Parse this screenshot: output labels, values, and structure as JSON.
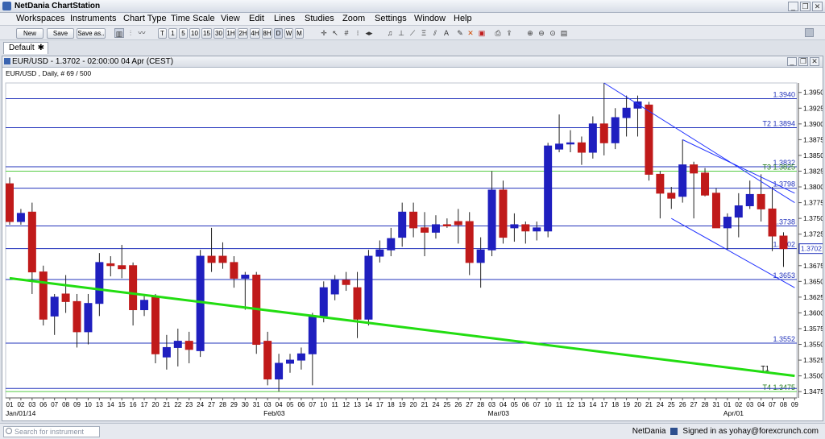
{
  "app": {
    "title": "NetDania ChartStation"
  },
  "menu": [
    "Workspaces",
    "Instruments",
    "Chart Type",
    "Time Scale",
    "View",
    "Edit",
    "Lines",
    "Studies",
    "Zoom",
    "Settings",
    "Window",
    "Help"
  ],
  "toolbar": {
    "new_label": "New",
    "save_label": "Save",
    "saveas_label": "Save as..",
    "timescales": [
      "T",
      "1",
      "5",
      "10",
      "15",
      "30",
      "1H",
      "2H",
      "4H",
      "8H",
      "D",
      "W",
      "M"
    ],
    "selected_timescale": "D"
  },
  "tabs": {
    "default_label": "Default"
  },
  "chart_window": {
    "title": "EUR/USD - 1.3702 - 02:00:00  04 Apr (CEST)"
  },
  "chart_data": {
    "type": "candlestick",
    "instrument_label": "EUR/USD , Daily, # 69 / 500",
    "ylim": [
      1.3465,
      1.3965
    ],
    "y_ticks": [
      "1.3950",
      "1.3925",
      "1.3900",
      "1.3875",
      "1.3850",
      "1.3825",
      "1.3800",
      "1.3775",
      "1.3750",
      "1.3725",
      "1.3700",
      "1.3675",
      "1.3650",
      "1.3625",
      "1.3600",
      "1.3575",
      "1.3550",
      "1.3525",
      "1.3500",
      "1.3475"
    ],
    "x_labels": [
      "01",
      "02",
      "03",
      "06",
      "07",
      "08",
      "09",
      "10",
      "13",
      "14",
      "15",
      "16",
      "17",
      "20",
      "21",
      "22",
      "23",
      "24",
      "27",
      "28",
      "29",
      "30",
      "31",
      "03",
      "04",
      "05",
      "06",
      "07",
      "10",
      "11",
      "12",
      "13",
      "14",
      "17",
      "18",
      "19",
      "20",
      "21",
      "24",
      "25",
      "26",
      "27",
      "28",
      "03",
      "04",
      "05",
      "06",
      "07",
      "10",
      "11",
      "12",
      "13",
      "14",
      "17",
      "18",
      "19",
      "20",
      "21",
      "24",
      "25",
      "26",
      "27",
      "28",
      "31",
      "01",
      "02",
      "03",
      "04",
      "07",
      "08",
      "09"
    ],
    "month_labels": [
      "Jan/01/14",
      "Feb/03",
      "Mar/03",
      "Apr/01"
    ],
    "month_label_index": [
      0,
      23,
      43,
      64
    ],
    "candles": [
      {
        "o": 1.3805,
        "h": 1.3815,
        "l": 1.374,
        "c": 1.3745
      },
      {
        "o": 1.3745,
        "h": 1.3765,
        "l": 1.374,
        "c": 1.3758
      },
      {
        "o": 1.376,
        "h": 1.3775,
        "l": 1.363,
        "c": 1.3665
      },
      {
        "o": 1.3665,
        "h": 1.3675,
        "l": 1.358,
        "c": 1.359
      },
      {
        "o": 1.3595,
        "h": 1.363,
        "l": 1.3565,
        "c": 1.3625
      },
      {
        "o": 1.363,
        "h": 1.366,
        "l": 1.36,
        "c": 1.3618
      },
      {
        "o": 1.3618,
        "h": 1.363,
        "l": 1.3545,
        "c": 1.357
      },
      {
        "o": 1.357,
        "h": 1.363,
        "l": 1.355,
        "c": 1.3615
      },
      {
        "o": 1.3615,
        "h": 1.3695,
        "l": 1.3595,
        "c": 1.368
      },
      {
        "o": 1.3678,
        "h": 1.369,
        "l": 1.3658,
        "c": 1.3675
      },
      {
        "o": 1.3675,
        "h": 1.3708,
        "l": 1.3655,
        "c": 1.367
      },
      {
        "o": 1.3675,
        "h": 1.368,
        "l": 1.358,
        "c": 1.3605
      },
      {
        "o": 1.3605,
        "h": 1.363,
        "l": 1.3595,
        "c": 1.362
      },
      {
        "o": 1.3625,
        "h": 1.363,
        "l": 1.352,
        "c": 1.3535
      },
      {
        "o": 1.353,
        "h": 1.3565,
        "l": 1.351,
        "c": 1.3545
      },
      {
        "o": 1.3545,
        "h": 1.3575,
        "l": 1.3515,
        "c": 1.3555
      },
      {
        "o": 1.3555,
        "h": 1.357,
        "l": 1.352,
        "c": 1.3542
      },
      {
        "o": 1.354,
        "h": 1.37,
        "l": 1.353,
        "c": 1.369
      },
      {
        "o": 1.369,
        "h": 1.3735,
        "l": 1.3665,
        "c": 1.368
      },
      {
        "o": 1.369,
        "h": 1.3712,
        "l": 1.367,
        "c": 1.368
      },
      {
        "o": 1.368,
        "h": 1.369,
        "l": 1.364,
        "c": 1.3655
      },
      {
        "o": 1.3655,
        "h": 1.3665,
        "l": 1.3605,
        "c": 1.366
      },
      {
        "o": 1.366,
        "h": 1.3665,
        "l": 1.3535,
        "c": 1.355
      },
      {
        "o": 1.3555,
        "h": 1.357,
        "l": 1.3485,
        "c": 1.3495
      },
      {
        "o": 1.3495,
        "h": 1.3535,
        "l": 1.3475,
        "c": 1.352
      },
      {
        "o": 1.352,
        "h": 1.3535,
        "l": 1.3505,
        "c": 1.3525
      },
      {
        "o": 1.3525,
        "h": 1.3545,
        "l": 1.351,
        "c": 1.3535
      },
      {
        "o": 1.3535,
        "h": 1.36,
        "l": 1.3485,
        "c": 1.3595
      },
      {
        "o": 1.3595,
        "h": 1.365,
        "l": 1.3585,
        "c": 1.364
      },
      {
        "o": 1.363,
        "h": 1.366,
        "l": 1.362,
        "c": 1.3652
      },
      {
        "o": 1.3652,
        "h": 1.3665,
        "l": 1.3635,
        "c": 1.3645
      },
      {
        "o": 1.364,
        "h": 1.3665,
        "l": 1.356,
        "c": 1.359
      },
      {
        "o": 1.359,
        "h": 1.37,
        "l": 1.358,
        "c": 1.369
      },
      {
        "o": 1.369,
        "h": 1.3715,
        "l": 1.368,
        "c": 1.37
      },
      {
        "o": 1.37,
        "h": 1.3735,
        "l": 1.369,
        "c": 1.3718
      },
      {
        "o": 1.372,
        "h": 1.3775,
        "l": 1.3705,
        "c": 1.376
      },
      {
        "o": 1.376,
        "h": 1.3775,
        "l": 1.372,
        "c": 1.3735
      },
      {
        "o": 1.3735,
        "h": 1.376,
        "l": 1.369,
        "c": 1.3728
      },
      {
        "o": 1.3728,
        "h": 1.3755,
        "l": 1.3718,
        "c": 1.374
      },
      {
        "o": 1.374,
        "h": 1.375,
        "l": 1.3735,
        "c": 1.3738
      },
      {
        "o": 1.3745,
        "h": 1.3765,
        "l": 1.371,
        "c": 1.374
      },
      {
        "o": 1.3745,
        "h": 1.376,
        "l": 1.366,
        "c": 1.368
      },
      {
        "o": 1.368,
        "h": 1.372,
        "l": 1.364,
        "c": 1.37
      },
      {
        "o": 1.37,
        "h": 1.3825,
        "l": 1.369,
        "c": 1.3795
      },
      {
        "o": 1.3795,
        "h": 1.381,
        "l": 1.371,
        "c": 1.372
      },
      {
        "o": 1.3735,
        "h": 1.3758,
        "l": 1.3713,
        "c": 1.374
      },
      {
        "o": 1.374,
        "h": 1.3745,
        "l": 1.371,
        "c": 1.373
      },
      {
        "o": 1.373,
        "h": 1.3745,
        "l": 1.3715,
        "c": 1.3735
      },
      {
        "o": 1.373,
        "h": 1.387,
        "l": 1.372,
        "c": 1.3865
      },
      {
        "o": 1.386,
        "h": 1.3915,
        "l": 1.3855,
        "c": 1.3868
      },
      {
        "o": 1.387,
        "h": 1.389,
        "l": 1.3855,
        "c": 1.387
      },
      {
        "o": 1.387,
        "h": 1.388,
        "l": 1.3835,
        "c": 1.3855
      },
      {
        "o": 1.3855,
        "h": 1.3912,
        "l": 1.3845,
        "c": 1.39
      },
      {
        "o": 1.39,
        "h": 1.3965,
        "l": 1.385,
        "c": 1.387
      },
      {
        "o": 1.387,
        "h": 1.3925,
        "l": 1.386,
        "c": 1.391
      },
      {
        "o": 1.391,
        "h": 1.3945,
        "l": 1.388,
        "c": 1.3925
      },
      {
        "o": 1.3925,
        "h": 1.3945,
        "l": 1.388,
        "c": 1.3935
      },
      {
        "o": 1.393,
        "h": 1.3935,
        "l": 1.381,
        "c": 1.382
      },
      {
        "o": 1.382,
        "h": 1.3825,
        "l": 1.375,
        "c": 1.379
      },
      {
        "o": 1.379,
        "h": 1.38,
        "l": 1.3765,
        "c": 1.3782
      },
      {
        "o": 1.3785,
        "h": 1.3875,
        "l": 1.3775,
        "c": 1.3835
      },
      {
        "o": 1.3835,
        "h": 1.384,
        "l": 1.375,
        "c": 1.3822
      },
      {
        "o": 1.3822,
        "h": 1.383,
        "l": 1.3785,
        "c": 1.3787
      },
      {
        "o": 1.379,
        "h": 1.3798,
        "l": 1.3735,
        "c": 1.3735
      },
      {
        "o": 1.3735,
        "h": 1.3758,
        "l": 1.37,
        "c": 1.3752
      },
      {
        "o": 1.3752,
        "h": 1.379,
        "l": 1.372,
        "c": 1.377
      },
      {
        "o": 1.377,
        "h": 1.381,
        "l": 1.3765,
        "c": 1.3788
      },
      {
        "o": 1.3788,
        "h": 1.382,
        "l": 1.3745,
        "c": 1.3765
      },
      {
        "o": 1.3765,
        "h": 1.38,
        "l": 1.3698,
        "c": 1.3722
      },
      {
        "o": 1.3722,
        "h": 1.3728,
        "l": 1.3673,
        "c": 1.3702
      }
    ],
    "horizontal_lines": [
      {
        "label": "1.3940",
        "y": 1.394,
        "color": "#2233bb"
      },
      {
        "label": "T2 1.3894",
        "y": 1.3894,
        "color": "#2233bb"
      },
      {
        "label": "1.3832",
        "y": 1.3832,
        "color": "#2233bb"
      },
      {
        "label": "T3 1.3825",
        "y": 1.3825,
        "color": "#55cc44"
      },
      {
        "label": "1.3798",
        "y": 1.3798,
        "color": "#2233bb"
      },
      {
        "label": "1.3738",
        "y": 1.3738,
        "color": "#2233bb"
      },
      {
        "label": "1.3702",
        "y": 1.3702,
        "color": "#2233bb"
      },
      {
        "label": "1.3653",
        "y": 1.3653,
        "color": "#2233bb"
      },
      {
        "label": "1.3552",
        "y": 1.3552,
        "color": "#2233bb"
      },
      {
        "label": "T4 1.3475",
        "y": 1.3475,
        "color": "#55cc44"
      },
      {
        "label": "",
        "y": 1.348,
        "color": "#2233bb"
      }
    ],
    "trendlines": [
      {
        "name": "T1",
        "x1": 0,
        "y1": 1.3655,
        "x2": 70,
        "y2": 1.35,
        "color": "#22dd11"
      },
      {
        "x1": 53,
        "y1": 1.3965,
        "x2": 70,
        "y2": 1.3775,
        "color": "#2233ff"
      },
      {
        "x1": 59,
        "y1": 1.375,
        "x2": 70,
        "y2": 1.364,
        "color": "#2233ff"
      },
      {
        "x1": 60,
        "y1": 1.3875,
        "x2": 70,
        "y2": 1.379,
        "color": "#2233ff"
      }
    ],
    "last_price": "1.3702",
    "up_color": "#1f1fbf",
    "down_color": "#c01a1a"
  },
  "status": {
    "search_placeholder": "Search for instrument",
    "brand": "NetDania",
    "signed_in": "Signed in as yohay@forexcrunch.com"
  }
}
